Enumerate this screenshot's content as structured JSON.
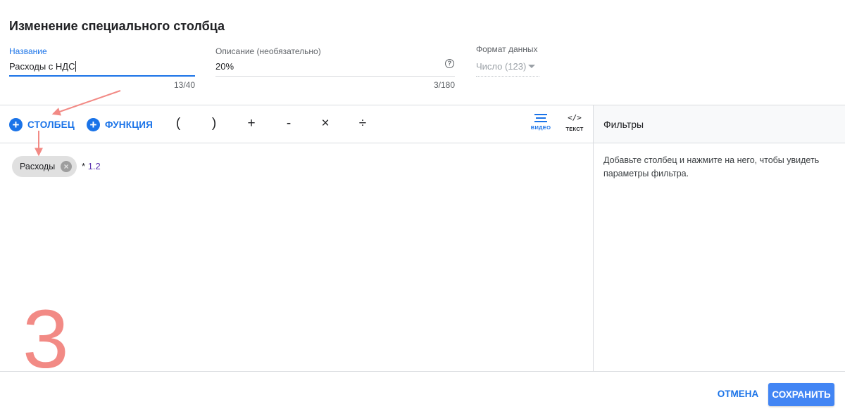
{
  "dialog": {
    "title": "Изменение специального столбца"
  },
  "fields": {
    "name": {
      "label": "Название",
      "value": "Расходы с НДС",
      "counter": "13/40"
    },
    "description": {
      "label": "Описание (необязательно)",
      "value": "20%",
      "counter": "3/180",
      "help_icon": "help-circle-icon"
    },
    "format": {
      "label": "Формат данных",
      "value": "Число (123)",
      "icon": "dropdown-arrow-icon"
    }
  },
  "toolbar": {
    "add_column": "СТОЛБЕЦ",
    "add_function": "ФУНКЦИЯ",
    "operators": [
      "(",
      ")",
      "+",
      "-",
      "×",
      "÷"
    ],
    "mode_visual": "ВИДЕО",
    "mode_text": "ТЕКСТ",
    "code_glyph": "</>"
  },
  "formula": {
    "chip_label": "Расходы",
    "operator": "*",
    "number": "1.2"
  },
  "filters": {
    "title": "Фильтры",
    "hint": "Добавьте столбец и нажмите на него, чтобы увидеть параметры фильтра."
  },
  "annotation": {
    "step": "3",
    "color": "#f28a85"
  },
  "footer": {
    "cancel": "ОТМЕНА",
    "save": "СОХРАНИТЬ"
  },
  "colors": {
    "accent": "#1a73e8",
    "save_bg": "#4285f4",
    "chip_bg": "#e0e0e0"
  }
}
